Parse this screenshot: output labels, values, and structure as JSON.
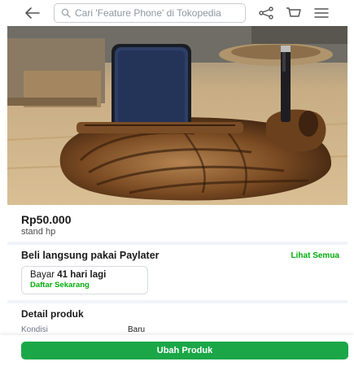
{
  "header": {
    "search_placeholder": "Cari 'Feature Phone' di Tokopedia"
  },
  "product": {
    "price": "Rp50.000",
    "name": "stand hp"
  },
  "paylater": {
    "title": "Beli langsung pakai Paylater",
    "see_all": "Lihat Semua",
    "pay_prefix": "Bayar",
    "pay_due": "41 hari lagi",
    "register_link": "Daftar Sekarang"
  },
  "details": {
    "title": "Detail produk",
    "condition_label": "Kondisi",
    "condition_value": "Baru"
  },
  "footer": {
    "edit_button": "Ubah Produk"
  },
  "colors": {
    "brand_green": "#03ac0e",
    "button_green": "#1ba748"
  },
  "icons": [
    "arrow-left-icon",
    "search-icon",
    "share-icon",
    "cart-icon",
    "hamburger-menu-icon"
  ]
}
